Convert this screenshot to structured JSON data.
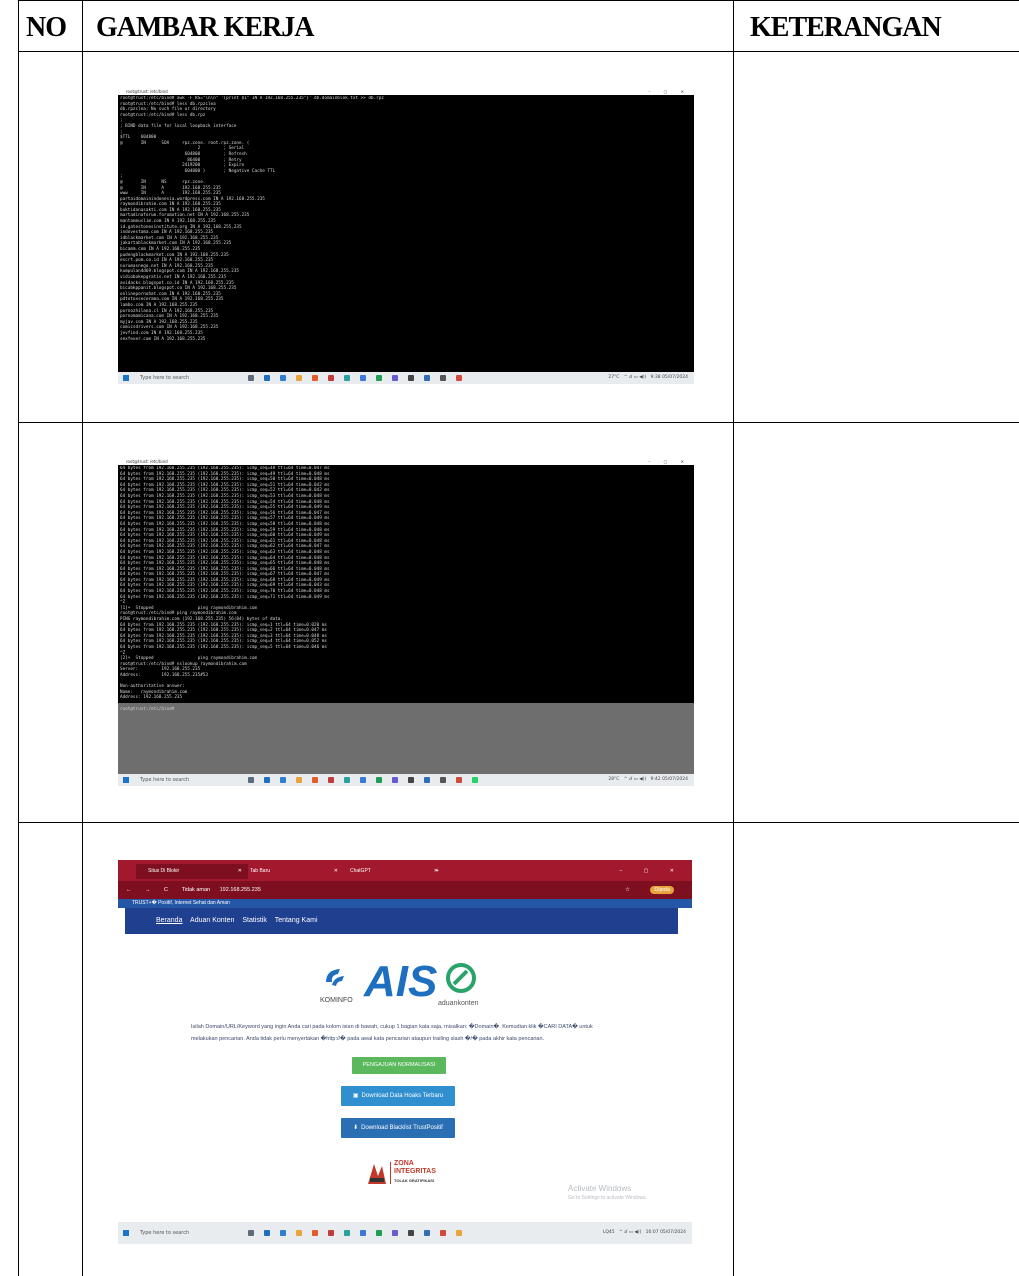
{
  "table": {
    "headers": {
      "no": "NO",
      "gambar": "GAMBAR KERJA",
      "keterangan": "KETERANGAN"
    }
  },
  "shot1": {
    "window_title": "root@trust: /etc/bind",
    "lines": [
      "root@trust:/etc/bind# awk -F RS=\"\\n\\n\" '{print $1\" IN A 192.168.255.235\"}' db.domainblok.txt >> db.rpz",
      "root@trust:/etc/bind# less db.rpzclea",
      "db.rpzclea: No such file or directory",
      "root@trust:/etc/bind# less db.rpz",
      ";",
      "; BIND data file for local loopback interface",
      ";",
      "$TTL    604800",
      "@       IN      SOA     rpz.zone. root.rpz.zone. (",
      "                              2         ; Serial",
      "                         604800         ; Refresh",
      "                          86400         ; Retry",
      "                        2419200         ; Expire",
      "                         604800 )       ; Negative Cache TTL",
      ";",
      "@       IN      NS      rpz.zone.",
      "@       IN      A       192.168.255.235",
      "www     IN      A       192.168.255.235",
      "partaidomainindonesia.wordpress.com IN A 192.168.255.235",
      "raymondibrahim.com IN A 192.168.255.235",
      "buktidanasakti.com IN A 192.168.255.235",
      "martadinaforum.forumotion.net IN A 192.168.255.235",
      "mantanmuslim.com IN A 192.168.255.235",
      "id.gatestonesinstitute.org IN A 192.168.255.235",
      "indovestama.com IN A 192.168.255.235",
      "idblackmarket.com IN A 192.168.255.235",
      "jakartablackmarket.com IN A 192.168.255.235",
      "bicamm.com IN A 192.168.255.235",
      "pudengblackmarket.com IN A 192.168.255.235",
      "escrt.pom.co.id IN A 192.168.255.235",
      "nurumasnego.net IN A 192.168.255.235",
      "kumpulan4d69.blogspot.com IN A 192.168.255.235",
      "vidiobokepgratis.net IN A 192.168.255.235",
      "avidacks.blogspot.co.id IN A 192.168.255.235",
      "bicabkppanit.blogspot.co IN A 192.168.255.235",
      "onlinepornohat.com IN A 192.168.255.235",
      "pdtotoxsecerama.com IN A 192.168.255.235",
      "lambo.com IN A 192.168.255.235",
      "pornozhilana.cl IN A 192.168.255.235",
      "pornomamicana.com IN A 192.168.255.235",
      "myjav.com IN A 192.168.255.235",
      "comicsdrivers.com IN A 192.168.255.235",
      "jevfind.com IN A 192.168.255.235",
      "sexfever.com IN A 192.168.255.235"
    ],
    "taskbar": {
      "search": "Type here to search",
      "weather": "27°C",
      "time": "9:38",
      "date": "05/07/2024"
    }
  },
  "shot2": {
    "window_title": "root@trust: /etc/bind",
    "lines": [
      "64 bytes from 192.168.255.235 (192.168.255.235): icmp_seq=48 ttl=64 time=0.047 ms",
      "64 bytes from 192.168.255.235 (192.168.255.235): icmp_seq=49 ttl=64 time=0.048 ms",
      "64 bytes from 192.168.255.235 (192.168.255.235): icmp_seq=50 ttl=64 time=0.048 ms",
      "64 bytes from 192.168.255.235 (192.168.255.235): icmp_seq=51 ttl=64 time=0.042 ms",
      "64 bytes from 192.168.255.235 (192.168.255.235): icmp_seq=52 ttl=64 time=0.042 ms",
      "64 bytes from 192.168.255.235 (192.168.255.235): icmp_seq=53 ttl=64 time=0.048 ms",
      "64 bytes from 192.168.255.235 (192.168.255.235): icmp_seq=54 ttl=64 time=0.048 ms",
      "64 bytes from 192.168.255.235 (192.168.255.235): icmp_seq=55 ttl=64 time=0.049 ms",
      "64 bytes from 192.168.255.235 (192.168.255.235): icmp_seq=56 ttl=64 time=0.047 ms",
      "64 bytes from 192.168.255.235 (192.168.255.235): icmp_seq=57 ttl=64 time=0.049 ms",
      "64 bytes from 192.168.255.235 (192.168.255.235): icmp_seq=58 ttl=64 time=0.048 ms",
      "64 bytes from 192.168.255.235 (192.168.255.235): icmp_seq=59 ttl=64 time=0.048 ms",
      "64 bytes from 192.168.255.235 (192.168.255.235): icmp_seq=60 ttl=64 time=0.049 ms",
      "64 bytes from 192.168.255.235 (192.168.255.235): icmp_seq=61 ttl=64 time=0.048 ms",
      "64 bytes from 192.168.255.235 (192.168.255.235): icmp_seq=62 ttl=64 time=0.047 ms",
      "64 bytes from 192.168.255.235 (192.168.255.235): icmp_seq=63 ttl=64 time=0.048 ms",
      "64 bytes from 192.168.255.235 (192.168.255.235): icmp_seq=64 ttl=64 time=0.048 ms",
      "64 bytes from 192.168.255.235 (192.168.255.235): icmp_seq=65 ttl=64 time=0.048 ms",
      "64 bytes from 192.168.255.235 (192.168.255.235): icmp_seq=66 ttl=64 time=0.048 ms",
      "64 bytes from 192.168.255.235 (192.168.255.235): icmp_seq=67 ttl=64 time=0.047 ms",
      "64 bytes from 192.168.255.235 (192.168.255.235): icmp_seq=68 ttl=64 time=0.049 ms",
      "64 bytes from 192.168.255.235 (192.168.255.235): icmp_seq=69 ttl=64 time=0.043 ms",
      "64 bytes from 192.168.255.235 (192.168.255.235): icmp_seq=70 ttl=64 time=0.048 ms",
      "64 bytes from 192.168.255.235 (192.168.255.235): icmp_seq=71 ttl=64 time=0.049 ms",
      "^Z",
      "[1]+  Stopped                 ping raymondibrahim.com",
      "root@trust:/etc/bind# ping raymondibrahim.com",
      "PING raymondibrahim.com (192.168.255.235) 56(84) bytes of data.",
      "64 bytes from 192.168.255.235 (192.168.255.235): icmp_seq=1 ttl=64 time=0.020 ms",
      "64 bytes from 192.168.255.235 (192.168.255.235): icmp_seq=2 ttl=64 time=0.047 ms",
      "64 bytes from 192.168.255.235 (192.168.255.235): icmp_seq=3 ttl=64 time=0.048 ms",
      "64 bytes from 192.168.255.235 (192.168.255.235): icmp_seq=4 ttl=64 time=0.052 ms",
      "64 bytes from 192.168.255.235 (192.168.255.235): icmp_seq=5 ttl=64 time=0.046 ms",
      "^Z",
      "[2]+  Stopped                 ping raymondibrahim.com",
      "root@trust:/etc/bind# nslookup raymondibrahim.com",
      "Server:         192.168.255.235",
      "Address:        192.168.255.235#53",
      "",
      "Non-authoritative answer:",
      "Name:   raymondibrahim.com",
      "Address: 192.168.255.235",
      "",
      "root@trust:/etc/bind# "
    ],
    "taskbar": {
      "search": "Type here to search",
      "weather": "28°C",
      "time": "9:42",
      "date": "05/07/2024"
    }
  },
  "shot3": {
    "tabs": [
      "Situs Di Blokir",
      "Tab Baru",
      "ChatGPT"
    ],
    "address_warning": "Tidak aman",
    "address": "192.168.255.235",
    "profile": "Dijeda",
    "site_top": "TRUST+� Positif, Internet Sehat dan Aman",
    "nav": [
      "Beranda",
      "Aduan Konten",
      "Statistik",
      "Tentang Kami"
    ],
    "logo": {
      "kominfo": "KOMINFO",
      "ais": "AIS",
      "sub": "aduankonten"
    },
    "description": "Isilah Domain/URL/Keyword yang ingin Anda cari pada kolom isian di bawah, cukup 1 bagian kata saja, misalkan: �Domain�. Kemudian klik �CARI DATA� untuk melakukan pencarian. Anda tidak perlu menyertakan �http://� pada awal kata pencarian ataupun trailing slash �/� pada akhir kata pencarian.",
    "buttons": {
      "normalisasi": "PENGAJUAN NORMALISASI",
      "hoaks": "Download Data Hoaks Terbaru",
      "blacklist": "Download Blacklist TrustPositif"
    },
    "zona": {
      "line1": "ZONA",
      "line2": "INTEGRITAS",
      "line3": "TOLAK GRATIFIKASI"
    },
    "watermark": {
      "line1": "Activate Windows",
      "line2": "Go to Settings to activate Windows."
    },
    "taskbar": {
      "search": "Type here to search",
      "weather": "LQ45",
      "time": "16:07",
      "date": "05/07/2024"
    }
  },
  "colors": {
    "browser_tab": "#a2182c",
    "site_nav": "#1f3f8f",
    "green_button": "#5cb85c",
    "blue_button": "#2f8fcf"
  }
}
